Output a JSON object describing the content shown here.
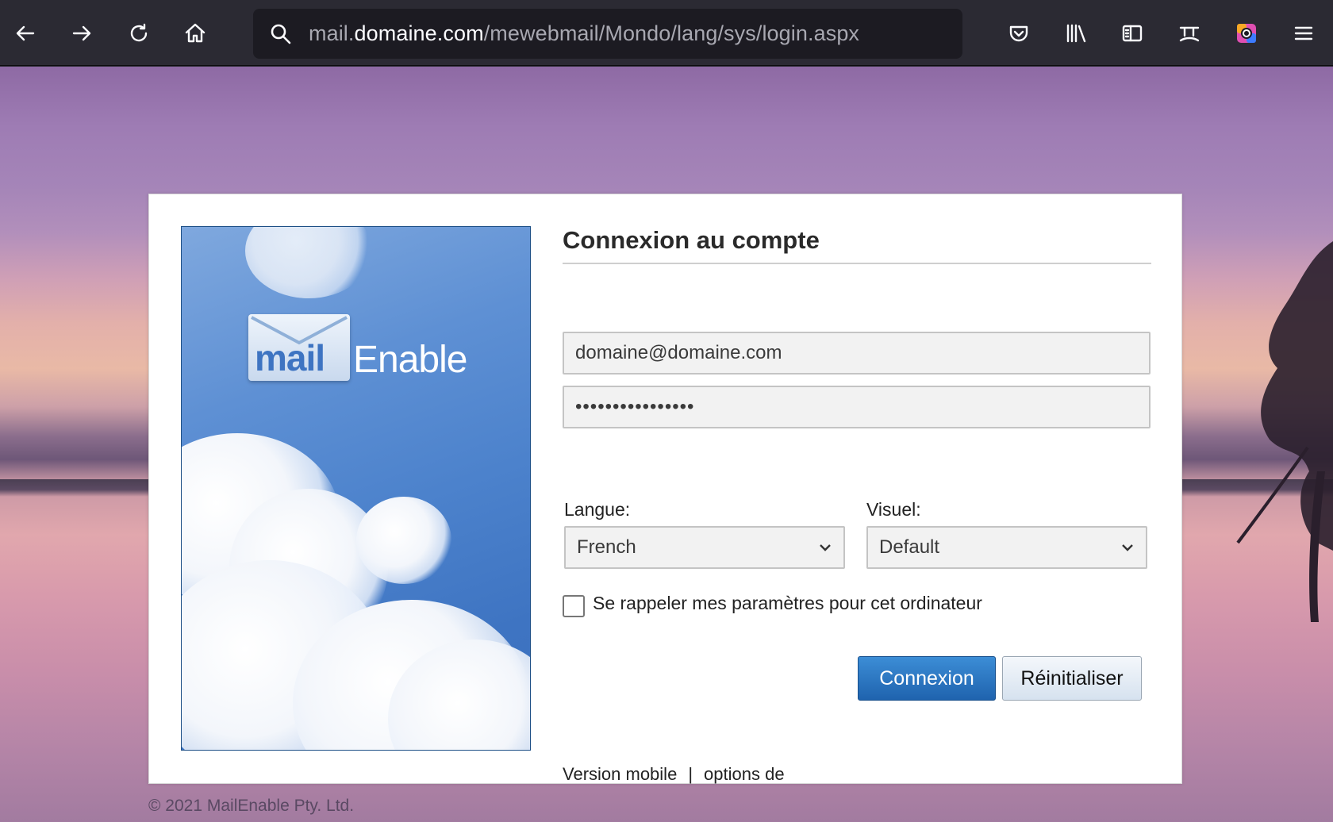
{
  "browser": {
    "url_prefix": "mail.",
    "url_domain": "domaine.com",
    "url_path": "/mewebmail/Mondo/lang/sys/login.aspx",
    "icons": [
      "back-icon",
      "forward-icon",
      "reload-icon",
      "home-icon",
      "search-icon",
      "pocket-icon",
      "library-icon",
      "sidebar-icon",
      "translate-icon",
      "extension-icon",
      "menu-icon"
    ]
  },
  "login": {
    "logo_mail": "mail",
    "logo_enable": "Enable",
    "title": "Connexion au compte",
    "username_value": "domaine@domaine.com",
    "password_value": "••••••••••••••••",
    "language_label": "Langue:",
    "language_value": "French",
    "skin_label": "Visuel:",
    "skin_value": "Default",
    "remember_label": "Se rappeler mes paramètres pour cet ordinateur",
    "remember_checked": false,
    "login_button": "Connexion",
    "reset_button": "Réinitialiser",
    "mobile_link": "Version mobile",
    "link_separator": "|",
    "options_link": "options de"
  },
  "footer": {
    "copyright": "© 2021 MailEnable Pty. Ltd."
  },
  "colors": {
    "toolbar_bg": "#2b2a33",
    "primary_button": "#1f63ae"
  }
}
